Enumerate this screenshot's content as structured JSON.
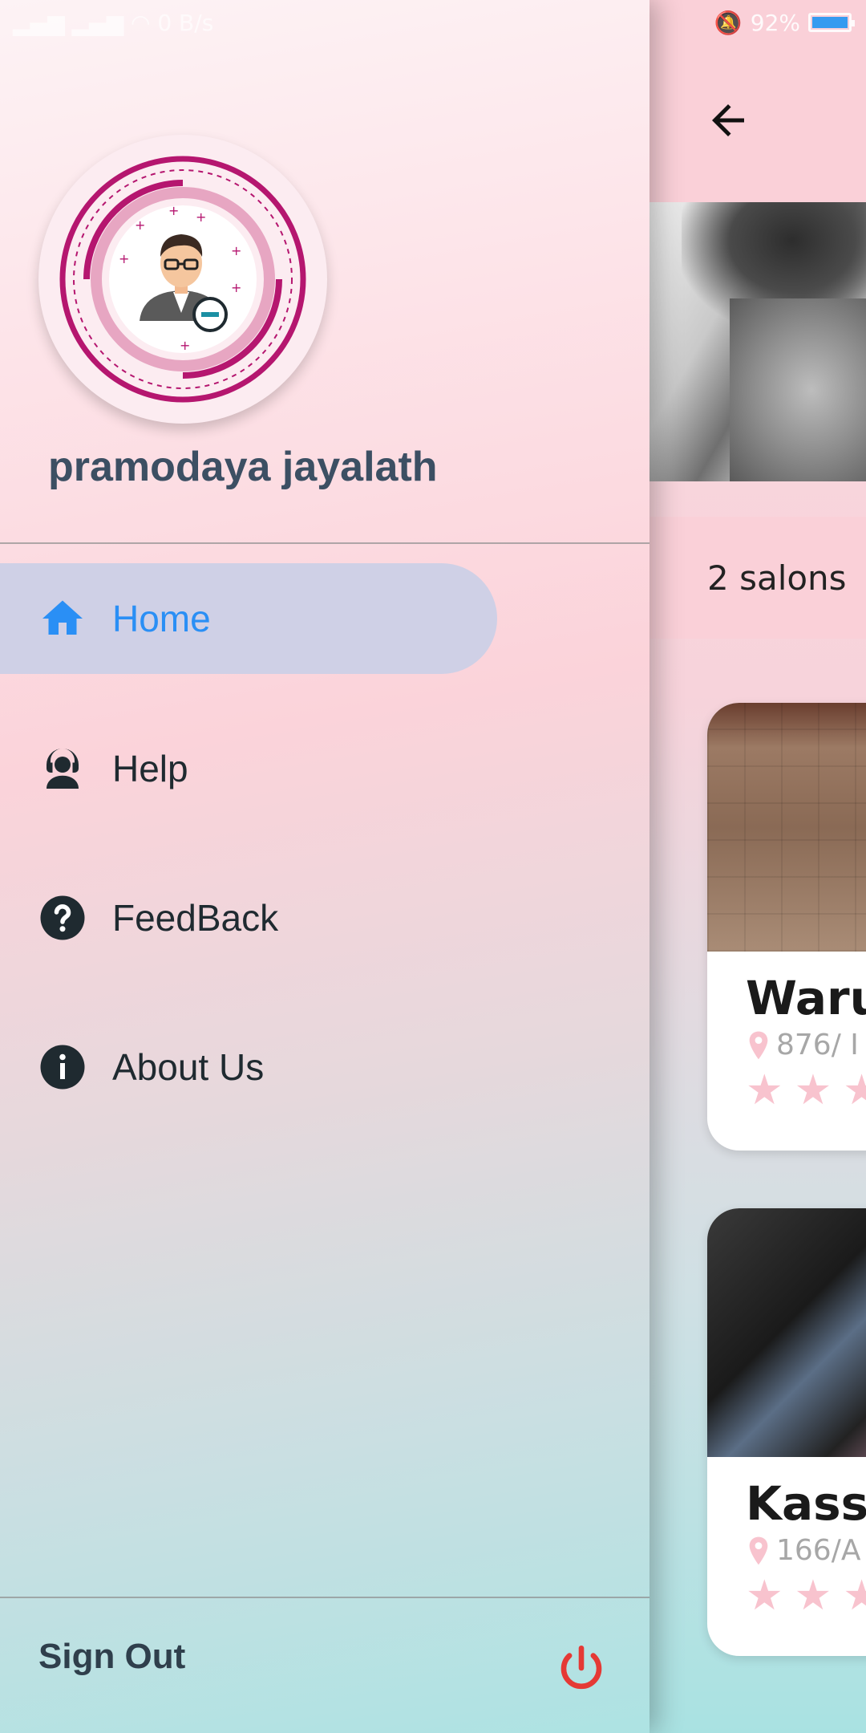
{
  "status_bar": {
    "left_text": "0 B/s",
    "battery_percent": "92%",
    "battery_level": 0.92
  },
  "drawer": {
    "profile": {
      "name": "pramodaya jayalath",
      "avatar_icon": "user-avatar-icon"
    },
    "menu": [
      {
        "label": "Home",
        "icon": "home-icon",
        "active": true
      },
      {
        "label": "Help",
        "icon": "support-agent-icon",
        "active": false
      },
      {
        "label": "FeedBack",
        "icon": "help-circle-icon",
        "active": false
      },
      {
        "label": "About Us",
        "icon": "info-icon",
        "active": false
      }
    ],
    "footer": {
      "label": "Sign Out",
      "icon": "power-icon"
    }
  },
  "background_app": {
    "back_icon": "arrow-back-icon",
    "salon_count_text": "2 salons",
    "cards": [
      {
        "name": "Waru",
        "address": "876/ I",
        "rating_stars_visible": 3
      },
      {
        "name": "Kass",
        "address": "166/A",
        "rating_stars_visible": 3
      }
    ]
  },
  "colors": {
    "accent_active": "#2a8ff5",
    "active_item_bg": "#cfd0e6",
    "power_icon": "#e53935",
    "star": "#f8c3ce",
    "app_bar": "#fad0d8"
  }
}
